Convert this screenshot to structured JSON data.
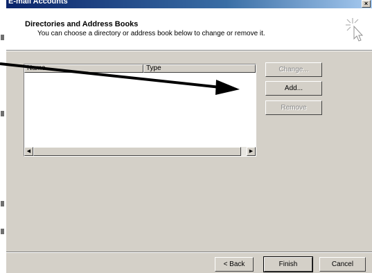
{
  "window": {
    "title": "E-mail Accounts",
    "close_glyph": "×"
  },
  "header": {
    "heading": "Directories and Address Books",
    "subheading": "You can choose a directory or address book below to change or remove it.",
    "icon": "wand-cursor-icon"
  },
  "list": {
    "columns": [
      "Name",
      "Type"
    ],
    "rows": []
  },
  "actions": {
    "change": "Change...",
    "add": "Add...",
    "remove": "Remove"
  },
  "footer": {
    "back": "< Back",
    "finish": "Finish",
    "cancel": "Cancel"
  },
  "annotation": {
    "type": "arrow",
    "color": "#000000"
  }
}
